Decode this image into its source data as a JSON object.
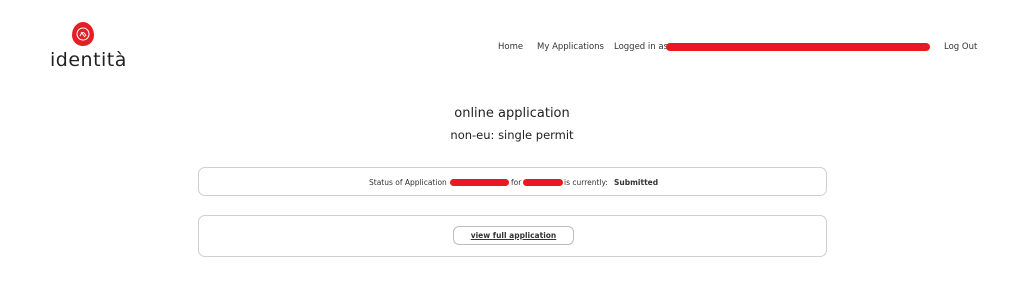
{
  "brand": {
    "name": "identità",
    "accent": "#e41f25"
  },
  "nav": {
    "home": "Home",
    "my_applications": "My Applications",
    "logged_in_prefix": "Logged in as",
    "log_out": "Log Out"
  },
  "page": {
    "title": "online application",
    "subtitle": "non-eu: single permit"
  },
  "status": {
    "prefix": "Status of Application",
    "for_text": "for",
    "currently_text": "is currently:",
    "value": "Submitted"
  },
  "actions": {
    "view_full_application": "view full application"
  },
  "colors": {
    "redaction": "#e8191f",
    "card_border": "#cfcfcf"
  }
}
